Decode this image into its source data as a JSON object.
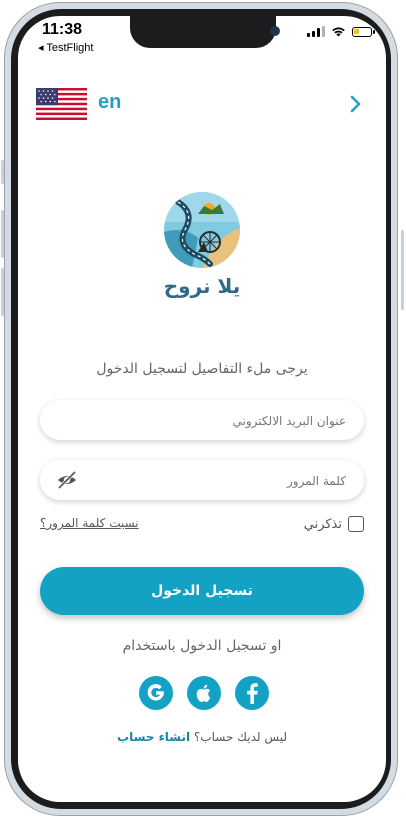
{
  "status_bar": {
    "time": "11:38",
    "back_app": "◂ TestFlight"
  },
  "language": {
    "code": "en",
    "flag_icon": "us-flag-icon",
    "next_icon": "chevron-right-icon"
  },
  "logo": {
    "text": "يلا نروح"
  },
  "form": {
    "instruction": "يرجى ملء التفاصيل لتسجيل الدخول",
    "email_placeholder": "عنوان البريد الالكتروني",
    "email_value": "",
    "password_placeholder": "كلمة المرور",
    "password_value": "",
    "remember_label": "تذكرني",
    "remember_checked": false,
    "forgot_label": "نسيت كلمة المرور؟",
    "login_label": "تسجيل الدخول"
  },
  "social": {
    "or_text": "او تسجيل الدخول باستخدام",
    "providers": [
      "google-icon",
      "apple-icon",
      "facebook-icon"
    ]
  },
  "signup": {
    "prompt": "ليس لديك حساب؟",
    "link": "انشاء حساب"
  },
  "colors": {
    "accent": "#14a2c4",
    "lang_text": "#2a9ec1",
    "logo_text": "#2d6b83"
  }
}
